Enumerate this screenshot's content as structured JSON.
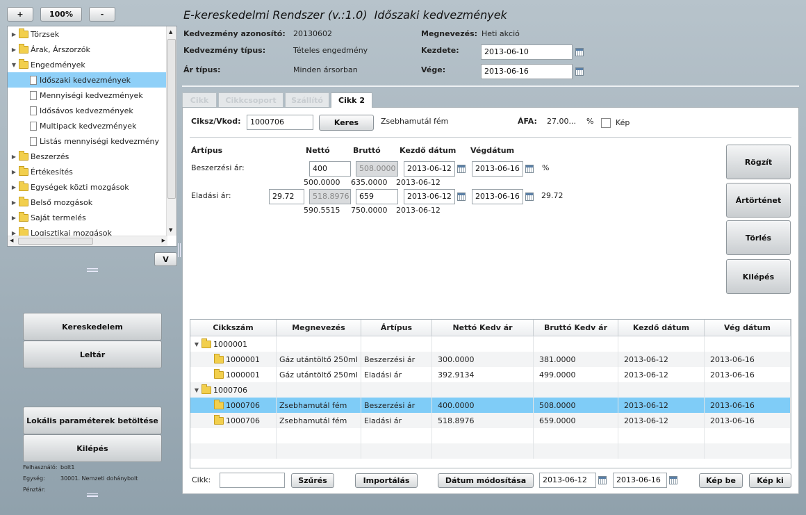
{
  "zoom": {
    "plus": "+",
    "level": "100%",
    "minus": "-"
  },
  "header": {
    "app_title": "E-kereskedelmi Rendszer (v.:1.0)",
    "page_title": "Időszaki kedvezmények"
  },
  "info": {
    "id_label": "Kedvezmény azonosító:",
    "id_value": "20130602",
    "type_label": "Kedvezmény típus:",
    "type_value": "Tételes engedmény",
    "price_type_label": "Ár típus:",
    "price_type_value": "Minden ársorban",
    "name_label": "Megnevezés:",
    "name_value": "Heti akció",
    "start_label": "Kezdete:",
    "start_value": "2013-06-10",
    "end_label": "Vége:",
    "end_value": "2013-06-16"
  },
  "tree": [
    {
      "label": "Törzsek",
      "type": "folder"
    },
    {
      "label": "Árak, Árszorzók",
      "type": "folder"
    },
    {
      "label": "Engedmények",
      "type": "folder-open"
    },
    {
      "label": "Időszaki kedvezmények",
      "type": "doc",
      "selected": true
    },
    {
      "label": "Mennyiségi kedvezmények",
      "type": "doc"
    },
    {
      "label": "Idősávos kedvezmények",
      "type": "doc"
    },
    {
      "label": "Multipack kedvezmények",
      "type": "doc"
    },
    {
      "label": "Listás mennyiségi kedvezmény",
      "type": "doc"
    },
    {
      "label": "Beszerzés",
      "type": "folder"
    },
    {
      "label": "Értékesítés",
      "type": "folder"
    },
    {
      "label": "Egységek közti mozgások",
      "type": "folder"
    },
    {
      "label": "Belső mozgások",
      "type": "folder"
    },
    {
      "label": "Saját termelés",
      "type": "folder"
    },
    {
      "label": "Logisztikai mozgások",
      "type": "folder"
    }
  ],
  "tree_v": "V",
  "sidebar": {
    "trade": "Kereskedelem",
    "inventory": "Leltár",
    "load_params": "Lokális paraméterek betöltése",
    "exit": "Kilépés",
    "user_label": "Felhasználó:",
    "user_value": "bolt1",
    "unit_label": "Egység:",
    "unit_value": "30001. Nemzeti dohánybolt",
    "register_label": "Pénztár:"
  },
  "tabs": [
    "Cikk",
    "Cikkcsoport",
    "Szállító",
    "Cikk 2"
  ],
  "form": {
    "code_label": "Ciksz/Vkod:",
    "code_value": "1000706",
    "search": "Keres",
    "item_name": "Zsebhamutál fém",
    "vat_label": "ÁFA:",
    "vat_value": "27.00...",
    "vat_unit": "%",
    "image_label": "Kép"
  },
  "prices": {
    "h_type": "Ártípus",
    "h_net": "Nettó",
    "h_gross": "Bruttó",
    "h_start": "Kezdő dátum",
    "h_end": "Végdátum",
    "buy_label": "Beszerzési ár:",
    "buy_net": "400",
    "buy_gross": "508.0000",
    "buy_start": "2013-06-12",
    "buy_end": "2013-06-16",
    "buy_unit": "%",
    "buy_net_sub": "500.0000",
    "buy_gross_sub": "635.0000",
    "buy_start_sub": "2013-06-12",
    "sell_label": "Eladási ár:",
    "sell_pct": "29.72",
    "sell_net": "518.8976",
    "sell_gross": "659",
    "sell_start": "2013-06-12",
    "sell_end": "2013-06-16",
    "sell_after": "29.72",
    "sell_net_sub": "590.5515",
    "sell_gross_sub": "750.0000",
    "sell_start_sub": "2013-06-12"
  },
  "actions": {
    "save": "Rögzít",
    "history": "Ártörténet",
    "delete": "Törlés",
    "exit": "Kilépés"
  },
  "grid": {
    "headers": [
      "Cikkszám",
      "Megnevezés",
      "Ártípus",
      "Nettó Kedv ár",
      "Bruttó Kedv ár",
      "Kezdő dátum",
      "Vég dátum"
    ],
    "rows": [
      {
        "group": true,
        "code": "1000001"
      },
      {
        "code": "1000001",
        "name": "Gáz utántöltő 250ml",
        "ptype": "Beszerzési ár",
        "net": "300.0000",
        "gross": "381.0000",
        "start": "2013-06-12",
        "end": "2013-06-16"
      },
      {
        "code": "1000001",
        "name": "Gáz utántöltő 250ml",
        "ptype": "Eladási ár",
        "net": "392.9134",
        "gross": "499.0000",
        "start": "2013-06-12",
        "end": "2013-06-16"
      },
      {
        "group": true,
        "code": "1000706"
      },
      {
        "code": "1000706",
        "name": "Zsebhamutál fém",
        "ptype": "Beszerzési ár",
        "net": "400.0000",
        "gross": "508.0000",
        "start": "2013-06-12",
        "end": "2013-06-16",
        "selected": true
      },
      {
        "code": "1000706",
        "name": "Zsebhamutál fém",
        "ptype": "Eladási ár",
        "net": "518.8976",
        "gross": "659.0000",
        "start": "2013-06-12",
        "end": "2013-06-16"
      }
    ]
  },
  "bottom": {
    "item_label": "Cikk:",
    "filter": "Szűrés",
    "import": "Importálás",
    "date_mod": "Dátum módosítása",
    "date_from": "2013-06-12",
    "date_to": "2013-06-16",
    "img_in": "Kép be",
    "img_out": "Kép ki"
  }
}
